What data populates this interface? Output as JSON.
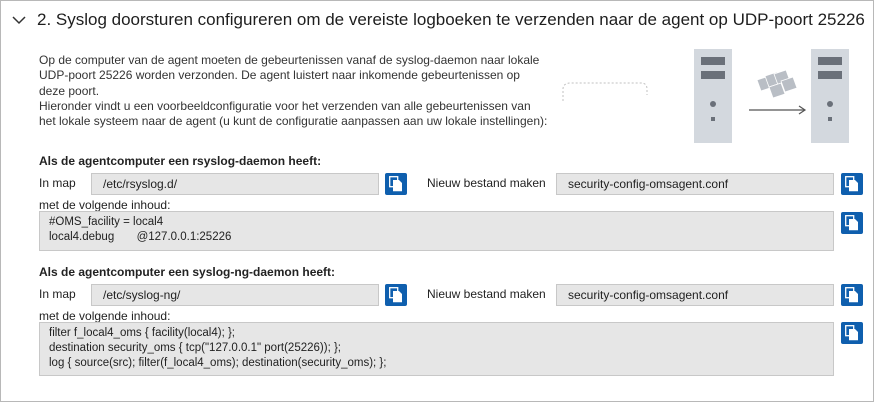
{
  "section": {
    "title": "2. Syslog doorsturen configureren om de vereiste logboeken te verzenden naar de agent op UDP-poort 25226"
  },
  "description": {
    "p1": "Op de computer van de agent moeten de gebeurtenissen vanaf de syslog-daemon naar lokale UDP-poort 25226 worden verzonden. De agent luistert naar inkomende gebeurtenissen op deze poort.",
    "p2": "Hieronder vindt u een voorbeeldconfiguratie voor het verzenden van alle gebeurtenissen van het lokale systeem naar de agent (u kunt de configuratie aanpassen aan uw lokale instellingen):"
  },
  "rsyslog": {
    "heading": "Als de agentcomputer een rsyslog-daemon heeft:",
    "folder_label": "In map",
    "folder_value": "/etc/rsyslog.d/",
    "file_label": "Nieuw bestand maken",
    "file_value": "security-config-omsagent.conf",
    "content_label": "met de volgende inhoud:",
    "content": "#OMS_facility = local4\nlocal4.debug       @127.0.0.1:25226"
  },
  "syslogng": {
    "heading": "Als de agentcomputer een syslog-ng-daemon heeft:",
    "folder_label": "In map",
    "folder_value": "/etc/syslog-ng/",
    "file_label": "Nieuw bestand maken",
    "file_value": "security-config-omsagent.conf",
    "content_label": "met de volgende inhoud:",
    "content": "filter f_local4_oms { facility(local4); };\ndestination security_oms { tcp(\"127.0.0.1\" port(25226)); };\nlog { source(src); filter(f_local4_oms); destination(security_oms); };"
  },
  "icons": {
    "collapse": "chevron-down-icon",
    "copy": "copy-icon"
  },
  "colors": {
    "accent": "#0f5fae",
    "field_bg": "#e6e6e6"
  }
}
